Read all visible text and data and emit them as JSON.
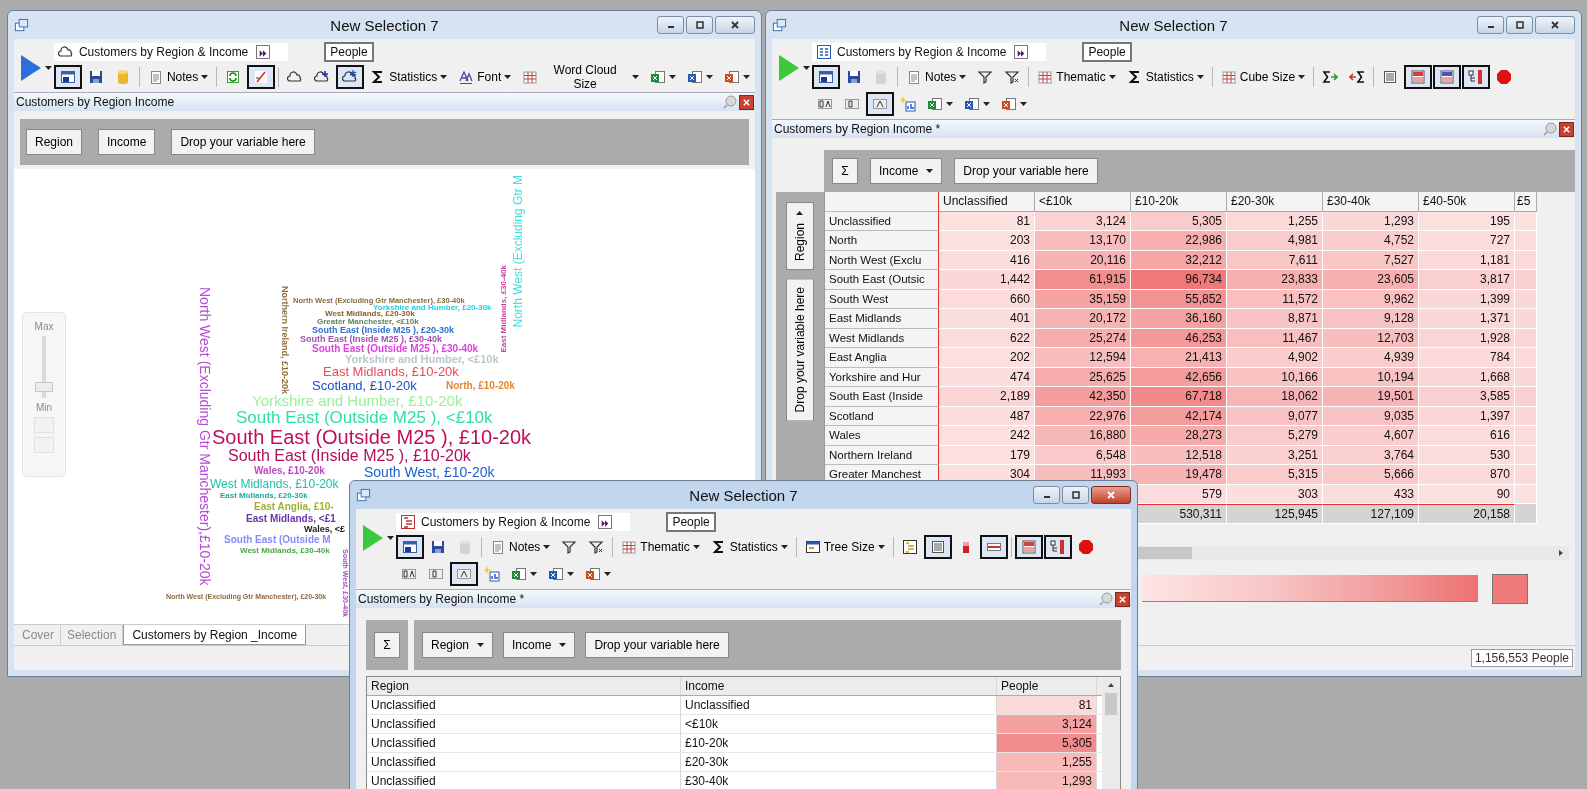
{
  "windows": [
    {
      "kind": "wordcloud",
      "title": "New Selection 7",
      "active": false,
      "play": {
        "color": "#2f6fdc"
      },
      "report": {
        "kind": "cloud",
        "name": "Customers by Region & Income"
      },
      "measure": "People",
      "toolbar": [
        [
          {
            "kind": "lock",
            "pressed": true,
            "dropdown": false,
            "disabled": false
          },
          {
            "kind": "save",
            "pressed": false,
            "dropdown": false,
            "disabled": false
          },
          {
            "kind": "database",
            "pressed": false,
            "dropdown": false,
            "disabled": false
          },
          {
            "kind": "separator"
          },
          {
            "kind": "notes",
            "label": "Notes",
            "pressed": false,
            "dropdown": true,
            "disabled": false
          },
          {
            "kind": "separator"
          },
          {
            "kind": "refresh",
            "pressed": false,
            "dropdown": false,
            "disabled": false
          },
          {
            "kind": "slash",
            "pressed": true,
            "dropdown": false,
            "disabled": false
          },
          {
            "kind": "separator"
          },
          {
            "kind": "cloud",
            "pressed": false,
            "dropdown": false,
            "disabled": false
          },
          {
            "kind": "cloudplus",
            "pressed": false,
            "dropdown": false,
            "disabled": false
          },
          {
            "kind": "cloudstar",
            "pressed": true,
            "dropdown": false,
            "disabled": false
          },
          {
            "kind": "sigma",
            "label": "Statistics",
            "pressed": false,
            "dropdown": true,
            "disabled": false
          },
          {
            "kind": "font",
            "label": "Font",
            "pressed": false,
            "dropdown": true,
            "disabled": false
          },
          {
            "kind": "grid",
            "label": "Word Cloud Size",
            "pressed": false,
            "dropdown": true,
            "disabled": false
          },
          {
            "kind": "excel",
            "pressed": false,
            "dropdown": true,
            "disabled": false
          },
          {
            "kind": "word",
            "pressed": false,
            "dropdown": true,
            "disabled": false
          },
          {
            "kind": "slides",
            "pressed": false,
            "dropdown": true,
            "disabled": false
          }
        ]
      ],
      "panel_title": "Customers by Region  Income",
      "pivot": [
        {
          "label": "Region",
          "dropdown": false
        },
        {
          "label": "Income",
          "dropdown": false
        },
        {
          "label": "Drop your variable here",
          "dropdown": false
        }
      ],
      "slider": {
        "max_label": "Max",
        "min_label": "Min",
        "level": 0.1
      },
      "words": [
        {
          "text": "North West (Excluding Gtr Manchester),£10-20k",
          "color": "#b848d8"
        },
        {
          "text": "North West (Excluding Gtr Manchester), £30-40k",
          "color": "#8a6a40"
        },
        {
          "text": "Yorkshire and Humber, £20-30k",
          "color": "#20d0e8"
        },
        {
          "text": "West Midlands, £20-30k",
          "color": "#8a6030"
        },
        {
          "text": "Greater Manchester, <£10k",
          "color": "#608060"
        },
        {
          "text": "South East (Inside M25 ), £20-30k",
          "color": "#2f6fd0"
        },
        {
          "text": "South East (Inside M25 ), £30-40k",
          "color": "#a050b0"
        },
        {
          "text": "South East (Outside M25 ), £30-40k",
          "color": "#e040e0"
        },
        {
          "text": "Yorkshire and Humber, <£10k",
          "color": "#b8c8c8"
        },
        {
          "text": "East Midlands, £10-20k",
          "color": "#f04858"
        },
        {
          "text": "Scotland, £10-20k",
          "color": "#1a50c0"
        },
        {
          "text": "North, £10-20k",
          "color": "#e08830"
        },
        {
          "text": "Yorkshire and Humber, £10-20k",
          "color": "#98f098"
        },
        {
          "text": "South East (Outside M25 ), <£10k",
          "color": "#30e0a0"
        },
        {
          "text": "South East (Outside M25 ), £10-20k",
          "color": "#c0105a"
        },
        {
          "text": "South East (Inside M25 ), £10-20k",
          "color": "#b01058"
        },
        {
          "text": "Wales, £10-20k",
          "color": "#c048c0"
        },
        {
          "text": "South West, £10-20k",
          "color": "#2060d0"
        },
        {
          "text": "West Midlands, £10-20k",
          "color": "#20c0a8"
        },
        {
          "text": "East Midlands, £20-30k",
          "color": "#20a8a0"
        },
        {
          "text": "East Anglia, £10-",
          "color": "#a0b030"
        },
        {
          "text": "East Midlands, <£1",
          "color": "#6838a8"
        },
        {
          "text": "Wales, <£",
          "color": "#202020"
        },
        {
          "text": "South East (Outside M",
          "color": "#8888ff"
        },
        {
          "text": "West Midlands, £30-40k",
          "color": "#48a848"
        },
        {
          "text": "North West (Excluding Gtr Manchester), £20-30k",
          "color": "#8a6a40"
        },
        {
          "text": "South West, £30-40k",
          "color": "#a050c0"
        },
        {
          "text": "North West (Excluding Gtr M",
          "color": "#40e0e0"
        },
        {
          "text": "Northern Ireland, £10-20k",
          "color": "#907040"
        },
        {
          "text": "East Midlands, £30-40k",
          "color": "#d040a0"
        }
      ],
      "tabs": [
        {
          "label": "Cover",
          "selected": false
        },
        {
          "label": "Selection",
          "selected": false
        },
        {
          "label": "Customers by Region _Income",
          "selected": true
        }
      ]
    },
    {
      "kind": "crosstab",
      "title": "New Selection 7",
      "active": false,
      "play": {
        "color": "#3cc83c"
      },
      "report": {
        "kind": "cube",
        "name": "Customers by Region & Income"
      },
      "measure": "People",
      "toolbar": [
        [
          {
            "kind": "lock",
            "pressed": true,
            "dropdown": false,
            "disabled": false
          },
          {
            "kind": "save",
            "pressed": false,
            "dropdown": false,
            "disabled": false
          },
          {
            "kind": "database",
            "pressed": false,
            "dropdown": false,
            "disabled": true
          },
          {
            "kind": "separator"
          },
          {
            "kind": "notes",
            "label": "Notes",
            "pressed": false,
            "dropdown": true,
            "disabled": false
          },
          {
            "kind": "filter",
            "pressed": false,
            "dropdown": false,
            "disabled": false
          },
          {
            "kind": "filterclear",
            "pressed": false,
            "dropdown": false,
            "disabled": false
          },
          {
            "kind": "separator"
          },
          {
            "kind": "grid",
            "label": "Thematic",
            "pressed": false,
            "dropdown": true,
            "disabled": false
          },
          {
            "kind": "sigma",
            "label": "Statistics",
            "pressed": false,
            "dropdown": true,
            "disabled": false
          },
          {
            "kind": "separator"
          },
          {
            "kind": "grid",
            "label": "Cube Size",
            "pressed": false,
            "dropdown": true,
            "disabled": false
          },
          {
            "kind": "separator"
          },
          {
            "kind": "sumforward",
            "pressed": false,
            "dropdown": false,
            "disabled": false
          },
          {
            "kind": "sumback",
            "pressed": false,
            "dropdown": false,
            "disabled": false
          },
          {
            "kind": "separator"
          },
          {
            "kind": "list",
            "pressed": false,
            "dropdown": false,
            "disabled": false
          },
          {
            "kind": "heat",
            "pressed": true,
            "dropdown": false,
            "disabled": false
          },
          {
            "kind": "heatblue",
            "pressed": true,
            "dropdown": false,
            "disabled": false
          },
          {
            "kind": "tree",
            "pressed": true,
            "dropdown": false,
            "disabled": false
          },
          {
            "kind": "stop",
            "pressed": false,
            "dropdown": false,
            "disabled": false
          }
        ],
        [
          {
            "kind": "format",
            "pressed": false,
            "dropdown": false,
            "disabled": false
          },
          {
            "kind": "zero",
            "pressed": false,
            "dropdown": false,
            "disabled": false
          },
          {
            "kind": "letter",
            "pressed": true,
            "dropdown": false,
            "disabled": false
          },
          {
            "kind": "newchart",
            "pressed": false,
            "dropdown": false,
            "disabled": false
          },
          {
            "kind": "excel",
            "pressed": false,
            "dropdown": true,
            "disabled": false
          },
          {
            "kind": "word",
            "pressed": false,
            "dropdown": true,
            "disabled": false
          },
          {
            "kind": "slides",
            "pressed": false,
            "dropdown": true,
            "disabled": false
          }
        ]
      ],
      "panel_title": "Customers by Region  Income *",
      "sigma": "Σ",
      "column_pivot": [
        {
          "label": "Income",
          "dropdown": true
        },
        {
          "label": "Drop your variable here",
          "dropdown": false
        }
      ],
      "row_pivot": [
        {
          "label": "Region",
          "dropdown": true
        },
        {
          "label": "Drop your variable here",
          "dropdown": false
        }
      ],
      "columns": [
        "Unclassified",
        "<£10k",
        "£10-20k",
        "£20-30k",
        "£30-40k",
        "£40-50k",
        "£5"
      ],
      "rows": [
        {
          "kind": "data",
          "label": "Unclassified",
          "cells": [
            "81",
            "3,124",
            "5,305",
            "1,255",
            "1,293",
            "195"
          ]
        },
        {
          "kind": "data",
          "label": "North",
          "cells": [
            "203",
            "13,170",
            "22,986",
            "4,981",
            "4,752",
            "727"
          ]
        },
        {
          "kind": "data",
          "label": "North West (Exclu",
          "cells": [
            "416",
            "20,116",
            "32,212",
            "7,611",
            "7,527",
            "1,181"
          ]
        },
        {
          "kind": "data",
          "label": "South East (Outsic",
          "cells": [
            "1,442",
            "61,915",
            "96,734",
            "23,833",
            "23,605",
            "3,817"
          ]
        },
        {
          "kind": "data",
          "label": "South West",
          "cells": [
            "660",
            "35,159",
            "55,852",
            "11,572",
            "9,962",
            "1,399"
          ]
        },
        {
          "kind": "data",
          "label": "East Midlands",
          "cells": [
            "401",
            "20,172",
            "36,160",
            "8,871",
            "9,128",
            "1,371"
          ]
        },
        {
          "kind": "data",
          "label": "West Midlands",
          "cells": [
            "622",
            "25,274",
            "46,253",
            "11,467",
            "12,703",
            "1,928"
          ]
        },
        {
          "kind": "data",
          "label": "East Anglia",
          "cells": [
            "202",
            "12,594",
            "21,413",
            "4,902",
            "4,939",
            "784"
          ]
        },
        {
          "kind": "data",
          "label": "Yorkshire and Hur",
          "cells": [
            "474",
            "25,625",
            "42,656",
            "10,166",
            "10,194",
            "1,668"
          ]
        },
        {
          "kind": "data",
          "label": "South East (Inside",
          "cells": [
            "2,189",
            "42,350",
            "67,718",
            "18,062",
            "19,501",
            "3,585"
          ]
        },
        {
          "kind": "data",
          "label": "Scotland",
          "cells": [
            "487",
            "22,976",
            "42,174",
            "9,077",
            "9,035",
            "1,397"
          ]
        },
        {
          "kind": "data",
          "label": "Wales",
          "cells": [
            "242",
            "16,880",
            "28,273",
            "5,279",
            "4,607",
            "616"
          ]
        },
        {
          "kind": "data",
          "label": "Northern Ireland",
          "cells": [
            "179",
            "6,548",
            "12,518",
            "3,251",
            "3,764",
            "530"
          ]
        },
        {
          "kind": "data",
          "label": "Greater Manchest",
          "cells": [
            "304",
            "11,993",
            "19,478",
            "5,315",
            "5,666",
            "870"
          ]
        },
        {
          "kind": "data",
          "label": null,
          "cells": [
            null,
            null,
            "579",
            "303",
            "433",
            "90"
          ]
        },
        {
          "kind": "total",
          "label": null,
          "cells": [
            null,
            null,
            "530,311",
            "125,945",
            "127,109",
            "20,158"
          ]
        }
      ],
      "status": "1,156,553 People"
    },
    {
      "kind": "table",
      "title": "New Selection 7",
      "active": true,
      "play": {
        "color": "#3cc83c"
      },
      "report": {
        "kind": "tree",
        "name": "Customers by Region & Income"
      },
      "measure": "People",
      "toolbar": [
        [
          {
            "kind": "lock",
            "pressed": true,
            "dropdown": false,
            "disabled": false
          },
          {
            "kind": "save",
            "pressed": false,
            "dropdown": false,
            "disabled": false
          },
          {
            "kind": "database",
            "pressed": false,
            "dropdown": false,
            "disabled": true
          },
          {
            "kind": "separator"
          },
          {
            "kind": "notes",
            "label": "Notes",
            "pressed": false,
            "dropdown": true,
            "disabled": false
          },
          {
            "kind": "filter",
            "pressed": false,
            "dropdown": false,
            "disabled": false
          },
          {
            "kind": "filterclear",
            "pressed": false,
            "dropdown": false,
            "disabled": false
          },
          {
            "kind": "separator"
          },
          {
            "kind": "grid",
            "label": "Thematic",
            "pressed": false,
            "dropdown": true,
            "disabled": false
          },
          {
            "kind": "sigma",
            "label": "Statistics",
            "pressed": false,
            "dropdown": true,
            "disabled": false
          },
          {
            "kind": "separator"
          },
          {
            "kind": "window",
            "label": "Tree Size",
            "pressed": false,
            "dropdown": true,
            "disabled": false
          },
          {
            "kind": "separator"
          },
          {
            "kind": "treelist",
            "pressed": false,
            "dropdown": false,
            "disabled": false
          },
          {
            "kind": "list",
            "pressed": true,
            "dropdown": false,
            "disabled": false
          },
          {
            "kind": "redbar",
            "pressed": false,
            "dropdown": false,
            "disabled": false
          },
          {
            "kind": "heatbar",
            "pressed": true,
            "dropdown": false,
            "disabled": false
          },
          {
            "kind": "separator"
          },
          {
            "kind": "heat",
            "pressed": true,
            "dropdown": false,
            "disabled": false
          },
          {
            "kind": "tree",
            "pressed": true,
            "dropdown": false,
            "disabled": false
          },
          {
            "kind": "stop",
            "pressed": false,
            "dropdown": false,
            "disabled": false
          }
        ],
        [
          {
            "kind": "format",
            "pressed": false,
            "dropdown": false,
            "disabled": false
          },
          {
            "kind": "zero",
            "pressed": false,
            "dropdown": false,
            "disabled": false
          },
          {
            "kind": "letter",
            "pressed": true,
            "dropdown": false,
            "disabled": false
          },
          {
            "kind": "newchart",
            "pressed": false,
            "dropdown": false,
            "disabled": false
          },
          {
            "kind": "excel",
            "pressed": false,
            "dropdown": true,
            "disabled": false
          },
          {
            "kind": "word",
            "pressed": false,
            "dropdown": true,
            "disabled": false
          },
          {
            "kind": "slides",
            "pressed": false,
            "dropdown": true,
            "disabled": false
          }
        ]
      ],
      "panel_title": "Customers by Region  Income *",
      "sigma": "Σ",
      "pivot": [
        {
          "label": "Region",
          "dropdown": true
        },
        {
          "label": "Income",
          "dropdown": true
        },
        {
          "label": "Drop your variable here",
          "dropdown": false
        }
      ],
      "columns": [
        "Region",
        "Income",
        "People"
      ],
      "rows": [
        [
          "Unclassified",
          "Unclassified",
          "81"
        ],
        [
          "Unclassified",
          "<£10k",
          "3,124"
        ],
        [
          "Unclassified",
          "£10-20k",
          "5,305"
        ],
        [
          "Unclassified",
          "£20-30k",
          "1,255"
        ],
        [
          "Unclassified",
          "£30-40k",
          "1,293"
        ]
      ]
    }
  ]
}
